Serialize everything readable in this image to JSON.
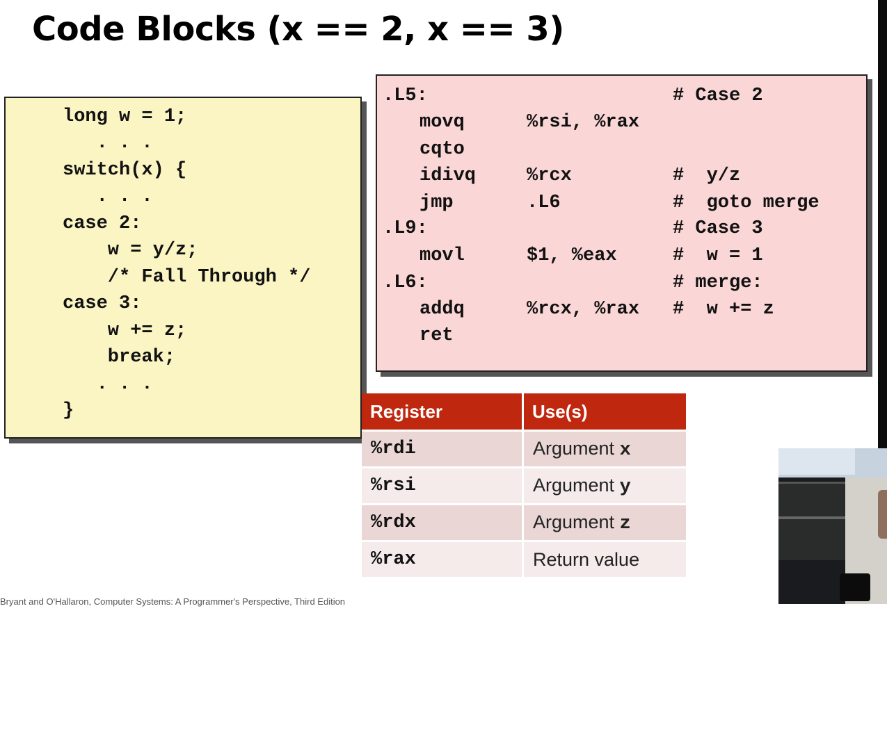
{
  "title": "Code Blocks (x == 2, x == 3)",
  "c_code": {
    "lines": [
      "long w = 1;",
      "   . . .",
      "switch(x) {",
      "   . . .",
      "case 2:",
      "    w = y/z;",
      "    /* Fall Through */",
      "case 3:",
      "    w += z;",
      "    break;",
      "   . . .",
      "}"
    ]
  },
  "asm_code": {
    "lines": [
      {
        "label": ".L5:",
        "instr": "",
        "operands": "",
        "comment": "# Case 2"
      },
      {
        "label": "",
        "instr": "movq",
        "operands": "%rsi, %rax",
        "comment": ""
      },
      {
        "label": "",
        "instr": "cqto",
        "operands": "",
        "comment": ""
      },
      {
        "label": "",
        "instr": "idivq",
        "operands": "%rcx",
        "comment": "#  y/z"
      },
      {
        "label": "",
        "instr": "jmp",
        "operands": ".L6",
        "comment": "#  goto merge"
      },
      {
        "label": ".L9:",
        "instr": "",
        "operands": "",
        "comment": "# Case 3"
      },
      {
        "label": "",
        "instr": "movl",
        "operands": "$1, %eax",
        "comment": "#  w = 1"
      },
      {
        "label": ".L6:",
        "instr": "",
        "operands": "",
        "comment": "# merge:"
      },
      {
        "label": "",
        "instr": "addq",
        "operands": "%rcx, %rax",
        "comment": "#  w += z"
      },
      {
        "label": "",
        "instr": "ret",
        "operands": "",
        "comment": ""
      }
    ]
  },
  "register_table": {
    "headers": [
      "Register",
      "Use(s)"
    ],
    "rows": [
      {
        "register": "%rdi",
        "use_text": "Argument",
        "use_arg": "x"
      },
      {
        "register": "%rsi",
        "use_text": "Argument",
        "use_arg": "y"
      },
      {
        "register": "%rdx",
        "use_text": "Argument",
        "use_arg": "z"
      },
      {
        "register": "%rax",
        "use_text": "Return value",
        "use_arg": ""
      }
    ]
  },
  "footer": "Bryant and O'Hallaron, Computer Systems: A Programmer's Perspective, Third Edition",
  "colors": {
    "c_box_bg": "#fbf5c4",
    "asm_box_bg": "#fad6d6",
    "table_header_bg": "#c0270f"
  }
}
